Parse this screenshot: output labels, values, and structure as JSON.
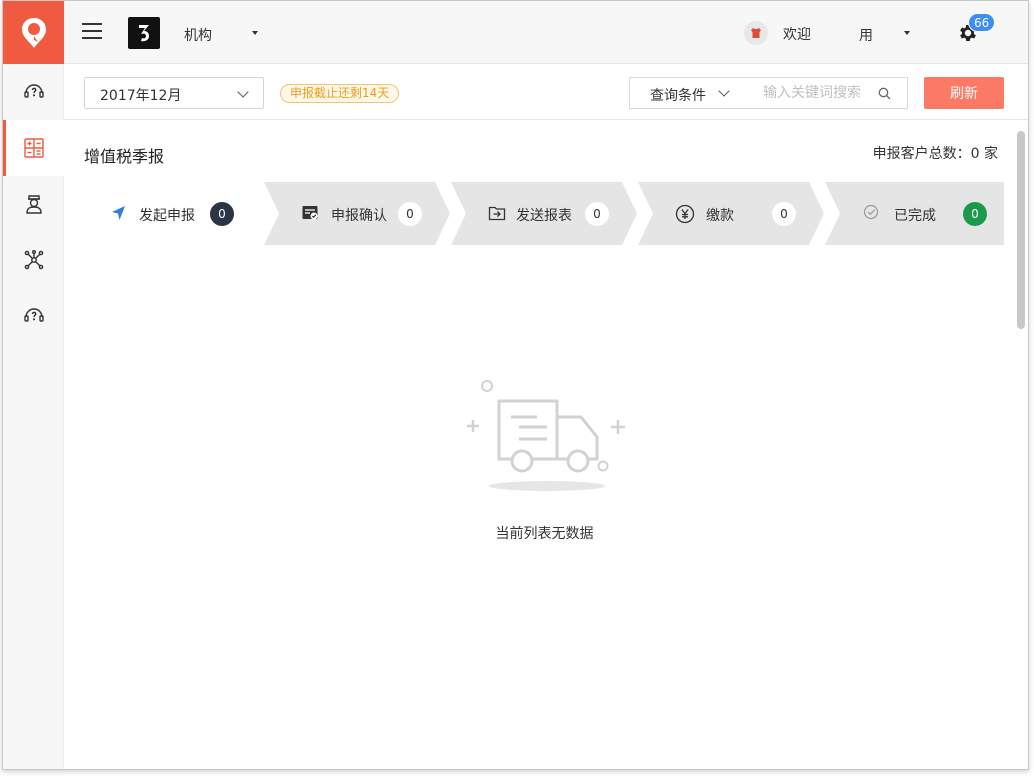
{
  "header": {
    "org_name": "机构",
    "welcome": "欢迎",
    "username": "用",
    "notification_count": "66"
  },
  "sidebar": {
    "items": [
      {
        "icon": "support-icon"
      },
      {
        "icon": "calculator-icon",
        "active": true
      },
      {
        "icon": "consultant-icon"
      },
      {
        "icon": "network-icon"
      },
      {
        "icon": "help-headset-icon"
      }
    ]
  },
  "toolbar": {
    "period": "2017年12月",
    "deadline_notice": "申报截止还剩14天",
    "query_label": "查询条件",
    "search_placeholder": "输入关键词搜索",
    "refresh_label": "刷新"
  },
  "main": {
    "title": "增值税季报",
    "total_label": "申报客户总数：",
    "total_value": "0",
    "total_unit": "家",
    "steps": [
      {
        "label": "发起申报",
        "count": "0",
        "icon": "send-arrow-icon"
      },
      {
        "label": "申报确认",
        "count": "0",
        "icon": "confirm-doc-icon"
      },
      {
        "label": "发送报表",
        "count": "0",
        "icon": "send-folder-icon"
      },
      {
        "label": "缴款",
        "count": "0",
        "icon": "yen-icon"
      },
      {
        "label": "已完成",
        "count": "0",
        "icon": "check-circle-icon"
      }
    ],
    "empty_text": "当前列表无数据"
  },
  "colors": {
    "brand": "#f05a40",
    "refresh": "#fa7a66",
    "badge": "#3d8ef0",
    "done": "#1a9b4b",
    "step_active_count": "#2b3545"
  }
}
